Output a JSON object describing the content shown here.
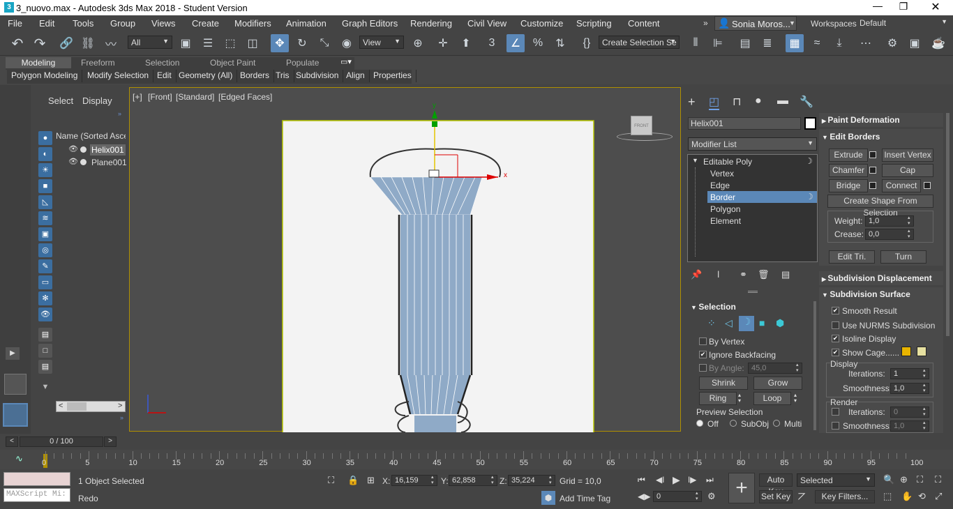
{
  "window": {
    "title": "3_nuovo.max - Autodesk 3ds Max 2018 - Student Version",
    "app_icon": "3",
    "controls": [
      "minimize-icon",
      "restore-icon",
      "close-icon"
    ]
  },
  "menu": [
    "File",
    "Edit",
    "Tools",
    "Group",
    "Views",
    "Create",
    "Modifiers",
    "Animation",
    "Graph Editors",
    "Rendering",
    "Civil View",
    "Customize",
    "Scripting",
    "Content"
  ],
  "user": {
    "name": "Sonia Moros...",
    "expand": "»"
  },
  "workspaces": {
    "label": "Workspaces:",
    "value": "Default"
  },
  "toolbar": {
    "filter": "All",
    "ref_coord": "View",
    "selection_set": "Create Selection Se"
  },
  "ribbon": {
    "tabs": [
      "Modeling",
      "Freeform",
      "Selection",
      "Object Paint",
      "Populate"
    ],
    "items": [
      "Polygon Modeling",
      "Modify Selection",
      "Edit",
      "Geometry (All)",
      "Borders",
      "Tris",
      "Subdivision",
      "Align",
      "Properties"
    ]
  },
  "scene_explorer": {
    "tabs": [
      "Select",
      "Display"
    ],
    "column": "Name (Sorted Ascen",
    "objects": [
      "Helix001",
      "Plane001"
    ]
  },
  "viewport": {
    "label": "[+] [Standard] [Edged Faces]",
    "label_parts": [
      "[+]",
      "[Front]",
      "[Standard]",
      "[Edged Faces]"
    ],
    "viewcube": "FRONT",
    "gizmo": {
      "y": "y",
      "x": "x"
    }
  },
  "command_panel": {
    "object_name": "Helix001",
    "modifier_list": "Modifier List",
    "stack": {
      "root": "Editable Poly",
      "subs": [
        "Vertex",
        "Edge",
        "Border",
        "Polygon",
        "Element"
      ],
      "selected": "Border"
    },
    "selection": {
      "title": "Selection",
      "by_vertex": "By Vertex",
      "ignore_backfacing": "Ignore Backfacing",
      "by_angle": "By Angle:",
      "angle": "45,0",
      "shrink": "Shrink",
      "grow": "Grow",
      "ring": "Ring",
      "loop": "Loop",
      "preview": "Preview Selection",
      "off": "Off",
      "subobj": "SubObj",
      "multi": "Multi"
    },
    "paint_deformation": "Paint Deformation",
    "edit_borders": {
      "title": "Edit Borders",
      "extrude": "Extrude",
      "insert_vertex": "Insert Vertex",
      "chamfer": "Chamfer",
      "cap": "Cap",
      "bridge": "Bridge",
      "connect": "Connect",
      "create_shape": "Create Shape From Selection",
      "weight_label": "Weight:",
      "weight": "1,0",
      "crease_label": "Crease:",
      "crease": "0,0",
      "edit_tri": "Edit Tri.",
      "turn": "Turn"
    },
    "subdivision_displacement": "Subdivision Displacement",
    "subdivision_surface": {
      "title": "Subdivision Surface",
      "smooth_result": "Smooth Result",
      "use_nurms": "Use NURMS Subdivision",
      "isoline": "Isoline Display",
      "show_cage": "Show Cage......",
      "display": "Display",
      "iterations_label": "Iterations:",
      "iterations": "1",
      "smoothness_label": "Smoothness:",
      "smoothness": "1,0",
      "render": "Render",
      "r_iterations": "0",
      "r_smoothness": "1,0"
    }
  },
  "timeline": {
    "frame": "0 / 100",
    "ticks": [
      "0",
      "5",
      "10",
      "15",
      "20",
      "25",
      "30",
      "35",
      "40",
      "45",
      "50",
      "55",
      "60",
      "65",
      "70",
      "75",
      "80",
      "85",
      "90",
      "95",
      "100"
    ]
  },
  "status": {
    "maxscript": "MAXScript Mi:",
    "selected": "1 Object Selected",
    "prompt": "Redo",
    "x_label": "X:",
    "x": "16,159",
    "y_label": "Y:",
    "y": "62,858",
    "z_label": "Z:",
    "z": "35,224",
    "grid": "Grid = 10,0",
    "add_time_tag": "Add Time Tag",
    "auto_key": "Auto Key",
    "set_key": "Set Key",
    "key_mode": "Selected",
    "key_filters": "Key Filters...",
    "frame_field": "0"
  },
  "colors": {
    "accent": "#5b88b8",
    "viewport_bg": "#f0f0f0",
    "border_highlight": "#b09000"
  }
}
